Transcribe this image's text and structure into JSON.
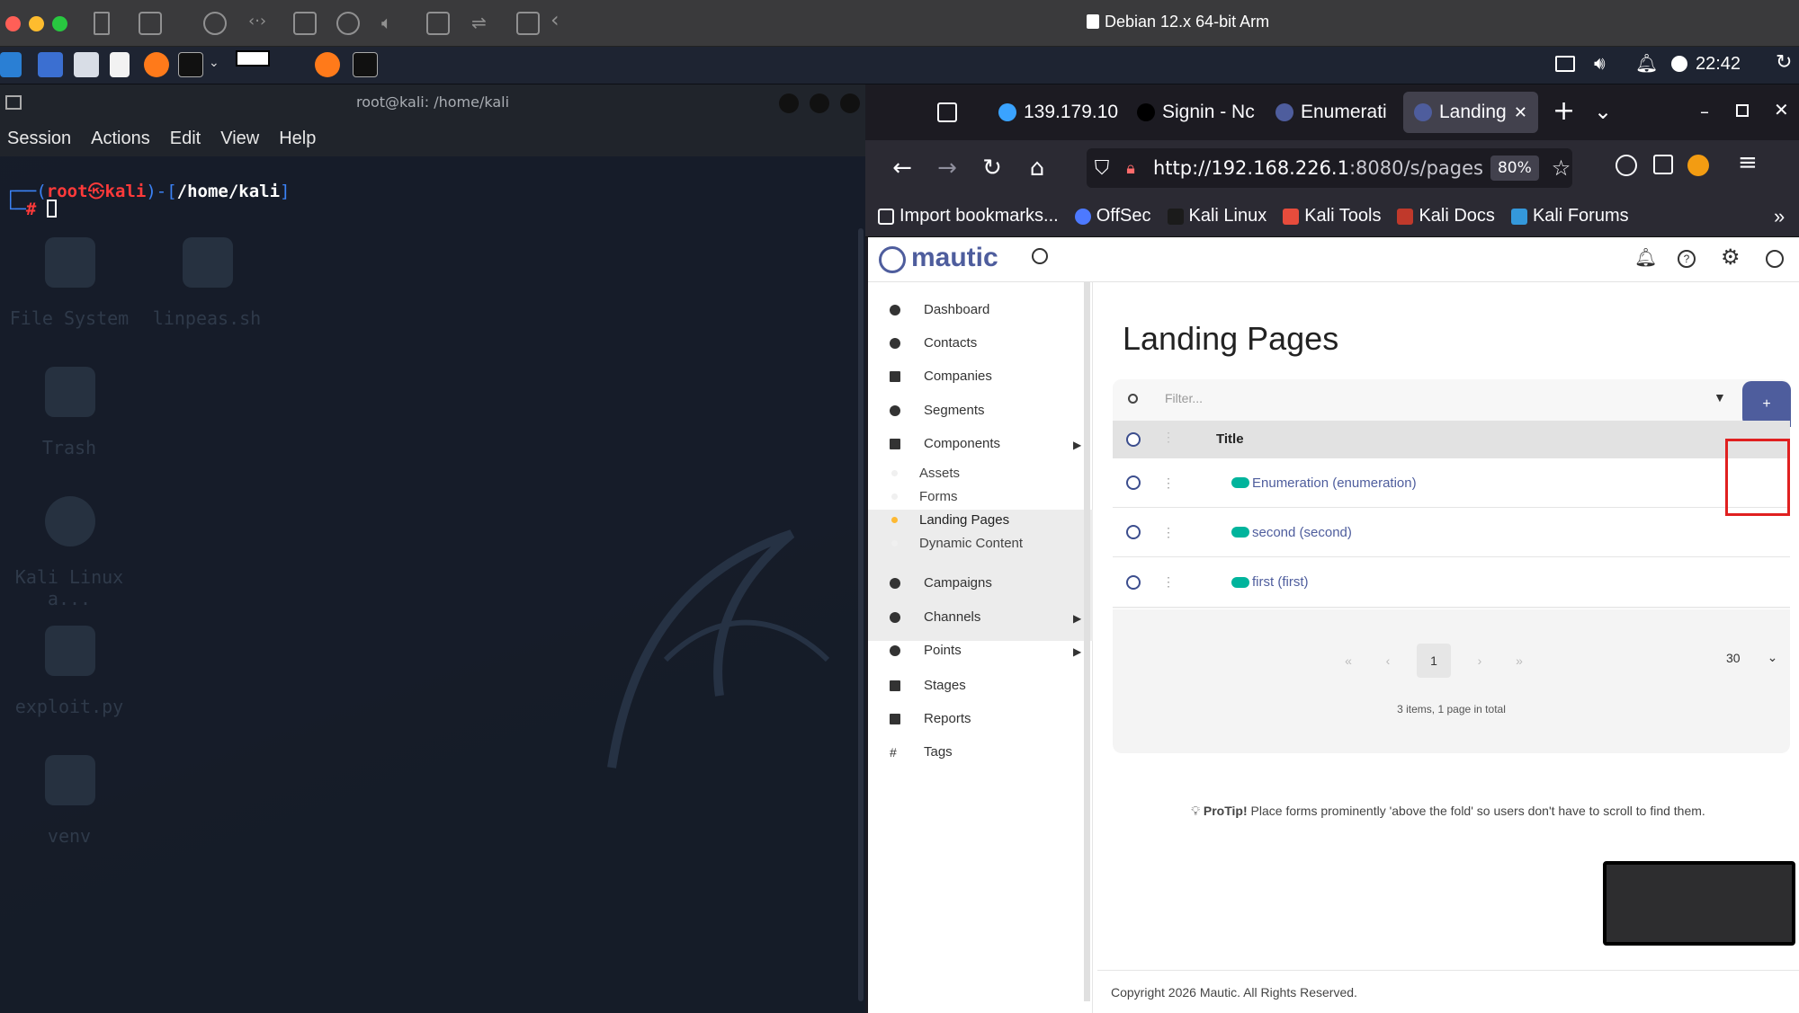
{
  "vm_title": "Debian 12.x 64-bit Arm",
  "clock": "22:42",
  "terminal": {
    "title": "root@kali: /home/kali",
    "menu": [
      "Session",
      "Actions",
      "Edit",
      "View",
      "Help"
    ],
    "prompt_user": "root",
    "prompt_host": "kali",
    "prompt_path": "/home/kali",
    "prompt_symbol": "#"
  },
  "desktop_icons": [
    "File System",
    "linpeas.sh",
    "Trash",
    "Kali Linux a...",
    "exploit.py",
    "venv"
  ],
  "browser": {
    "tabs": [
      {
        "label": "139.179.10"
      },
      {
        "label": "Signin - Nc"
      },
      {
        "label": "Enumerati"
      },
      {
        "label": "Landing"
      }
    ],
    "url_host": "http://192.168.226.1",
    "url_rest": ":8080/s/pages",
    "zoom": "80%",
    "bookmarks": [
      "Import bookmarks...",
      "OffSec",
      "Kali Linux",
      "Kali Tools",
      "Kali Docs",
      "Kali Forums"
    ]
  },
  "mautic": {
    "logo": "mautic",
    "sidebar": [
      "Dashboard",
      "Contacts",
      "Companies",
      "Segments",
      "Components"
    ],
    "components_sub": [
      "Assets",
      "Forms",
      "Landing Pages",
      "Dynamic Content"
    ],
    "sidebar_bottom": [
      "Campaigns",
      "Channels",
      "Points",
      "Stages",
      "Reports",
      "Tags"
    ],
    "page_title": "Landing Pages",
    "filter_placeholder": "Filter...",
    "add_label": "+",
    "column_title": "Title",
    "rows": [
      "Enumeration (enumeration)",
      "second (second)",
      "first (first)"
    ],
    "pagination": {
      "first": "«",
      "prev": "‹",
      "page": "1",
      "next": "›",
      "last": "»",
      "per_page": "30"
    },
    "total": "3 items, 1 page in total",
    "protip_label": "ProTip!",
    "protip_text": "Place forms prominently 'above the fold' so users don't have to scroll to find them.",
    "copyright": "Copyright 2026 Mautic. All Rights Reserved."
  },
  "colors": {
    "accent": "#4e5d9d",
    "toggle": "#00b49c",
    "highlight": "#e02020"
  }
}
